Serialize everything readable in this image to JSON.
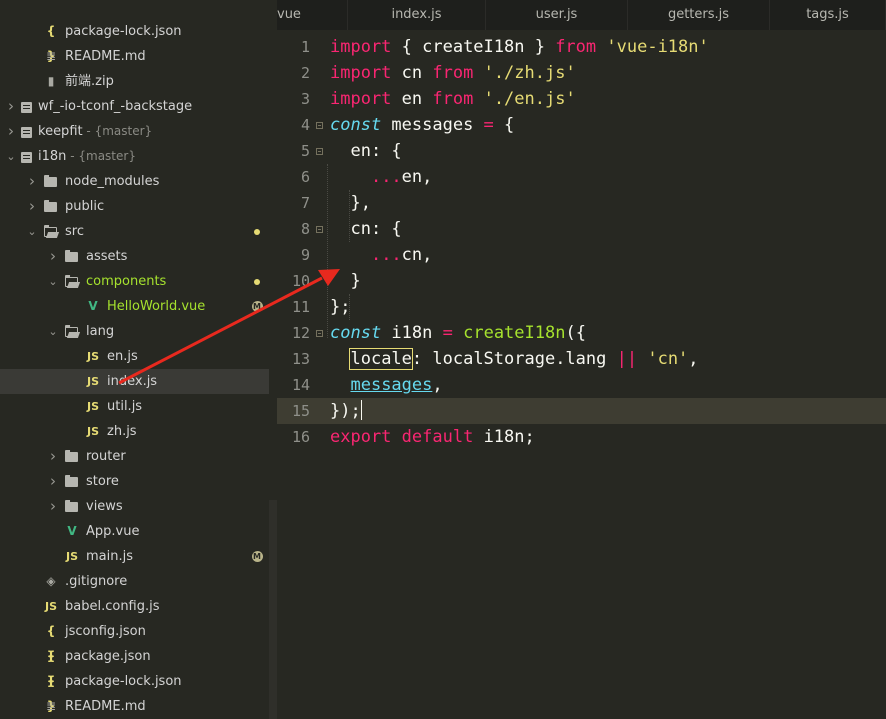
{
  "sidebar": {
    "items": [
      {
        "label": "package-lock.json",
        "icon": "json-icon",
        "glyph": "{ }",
        "indent": 2,
        "arrow": ""
      },
      {
        "label": "README.md",
        "icon": "markdown-icon",
        "glyph": "≣",
        "indent": 2,
        "arrow": ""
      },
      {
        "label": "前端.zip",
        "icon": "zip-icon",
        "glyph": "▮",
        "indent": 2,
        "arrow": ""
      },
      {
        "label": "wf_-io-tconf_-backstage",
        "icon": "repo-icon",
        "indent": 1,
        "arrow": "closed"
      },
      {
        "label": "keepfit",
        "branch": " - {master}",
        "icon": "repo-icon",
        "indent": 1,
        "arrow": "closed"
      },
      {
        "label": "i18n",
        "branch": " - {master}",
        "icon": "repo-icon",
        "indent": 1,
        "arrow": "open"
      },
      {
        "label": "node_modules",
        "icon": "folder-icon",
        "indent": 2,
        "arrow": "closed"
      },
      {
        "label": "public",
        "icon": "folder-icon",
        "indent": 2,
        "arrow": "closed"
      },
      {
        "label": "src",
        "icon": "folder-open-icon",
        "indent": 2,
        "arrow": "open",
        "badge": "dot"
      },
      {
        "label": "assets",
        "icon": "folder-icon",
        "indent": 3,
        "arrow": "closed"
      },
      {
        "label": "components",
        "icon": "folder-open-icon",
        "indent": 3,
        "arrow": "open",
        "badge": "dot",
        "color": "#a6e22e"
      },
      {
        "label": "HelloWorld.vue",
        "icon": "vue-icon",
        "glyph": "V",
        "indent": 4,
        "arrow": "",
        "badge": "M",
        "color": "#a6e22e"
      },
      {
        "label": "lang",
        "icon": "folder-open-icon",
        "indent": 3,
        "arrow": "open"
      },
      {
        "label": "en.js",
        "icon": "js-icon",
        "glyph": "JS",
        "indent": 4,
        "arrow": ""
      },
      {
        "label": "index.js",
        "icon": "js-icon",
        "glyph": "JS",
        "indent": 4,
        "arrow": "",
        "selected": true
      },
      {
        "label": "util.js",
        "icon": "js-icon",
        "glyph": "JS",
        "indent": 4,
        "arrow": ""
      },
      {
        "label": "zh.js",
        "icon": "js-icon",
        "glyph": "JS",
        "indent": 4,
        "arrow": ""
      },
      {
        "label": "router",
        "icon": "folder-icon",
        "indent": 3,
        "arrow": "closed"
      },
      {
        "label": "store",
        "icon": "folder-icon",
        "indent": 3,
        "arrow": "closed"
      },
      {
        "label": "views",
        "icon": "folder-icon",
        "indent": 3,
        "arrow": "closed"
      },
      {
        "label": "App.vue",
        "icon": "vue-icon",
        "glyph": "V",
        "indent": 3,
        "arrow": ""
      },
      {
        "label": "main.js",
        "icon": "js-icon",
        "glyph": "JS",
        "indent": 3,
        "arrow": "",
        "badge": "M"
      },
      {
        "label": ".gitignore",
        "icon": "git-icon",
        "glyph": "◈",
        "indent": 2,
        "arrow": ""
      },
      {
        "label": "babel.config.js",
        "icon": "js-icon",
        "glyph": "JS",
        "indent": 2,
        "arrow": ""
      },
      {
        "label": "jsconfig.json",
        "icon": "json-icon",
        "glyph": "{ }",
        "indent": 2,
        "arrow": ""
      },
      {
        "label": "package.json",
        "icon": "json-icon",
        "glyph": "{ }",
        "indent": 2,
        "arrow": ""
      },
      {
        "label": "package-lock.json",
        "icon": "json-icon",
        "glyph": "{ }",
        "indent": 2,
        "arrow": ""
      },
      {
        "label": "README.md",
        "icon": "markdown-icon",
        "glyph": "≣",
        "indent": 2,
        "arrow": ""
      }
    ]
  },
  "tabs": [
    {
      "label": "vue",
      "active": false
    },
    {
      "label": "index.js",
      "active": true
    },
    {
      "label": "user.js",
      "active": false
    },
    {
      "label": "getters.js",
      "active": false
    },
    {
      "label": "tags.js",
      "active": false
    }
  ],
  "editor": {
    "lines": [
      {
        "n": "1",
        "html": "<span class=\"kw\">import</span> { createI18n } <span class=\"kw\">from</span> <span class=\"st\">'vue-i18n'</span>"
      },
      {
        "n": "2",
        "html": "<span class=\"kw\">import</span> cn <span class=\"kw\">from</span> <span class=\"st\">'./zh.js'</span>"
      },
      {
        "n": "3",
        "html": "<span class=\"kw\">import</span> en <span class=\"kw\">from</span> <span class=\"st\">'./en.js'</span>"
      },
      {
        "n": "4",
        "fold": true,
        "html": "<span class=\"fn\">const</span> messages <span class=\"kw\">=</span> {"
      },
      {
        "n": "5",
        "fold": true,
        "html": "  en: {"
      },
      {
        "n": "6",
        "html": "    <span class=\"kw\">...</span>en,"
      },
      {
        "n": "7",
        "html": "  },"
      },
      {
        "n": "8",
        "fold": true,
        "html": "  cn: {"
      },
      {
        "n": "9",
        "html": "    <span class=\"kw\">...</span>cn,"
      },
      {
        "n": "10",
        "html": "  }"
      },
      {
        "n": "11",
        "html": "};"
      },
      {
        "n": "12",
        "fold": true,
        "html": "<span class=\"fn\">const</span> i18n <span class=\"kw\">=</span> <span class=\"fnc\">createI18n</span>({"
      },
      {
        "n": "13",
        "html": "  <span class=\"prop-box\">locale</span>: localStorage.lang <span class=\"kw\">||</span> <span class=\"st\">'cn'</span>,"
      },
      {
        "n": "14",
        "html": "  <span class=\"underline\">messages</span>,"
      },
      {
        "n": "15",
        "active": true,
        "html": "});<span class=\"cursor\"></span>"
      },
      {
        "n": "16",
        "html": "<span class=\"kw\">export</span> <span class=\"kw\">default</span> i18n;"
      }
    ]
  },
  "colors": {
    "accent": "#f92672",
    "string": "#e6db74",
    "func": "#a6e22e",
    "keyword2": "#66d9ef",
    "arrow": "#e8291e"
  }
}
